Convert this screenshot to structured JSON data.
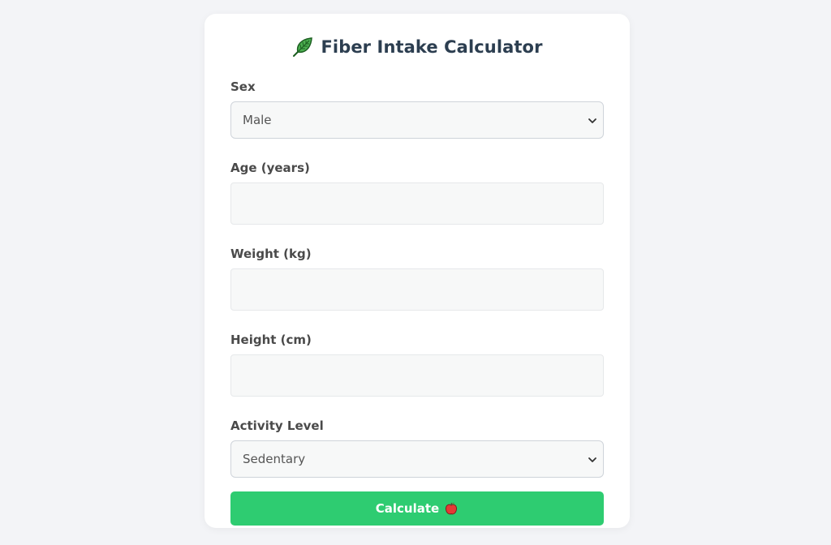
{
  "app": {
    "title": "Fiber Intake Calculator",
    "title_icon": "leaf-icon"
  },
  "form": {
    "sex": {
      "label": "Sex",
      "value": "Male"
    },
    "age": {
      "label": "Age (years)",
      "value": ""
    },
    "weight": {
      "label": "Weight (kg)",
      "value": ""
    },
    "height": {
      "label": "Height (cm)",
      "value": ""
    },
    "activity": {
      "label": "Activity Level",
      "value": "Sedentary"
    },
    "submit": {
      "label": "Calculate",
      "icon": "apple-icon"
    }
  },
  "colors": {
    "accent": "#2ecc71",
    "page_background": "#f3f4f7",
    "card_background": "#ffffff",
    "title_text": "#2c3e50"
  }
}
